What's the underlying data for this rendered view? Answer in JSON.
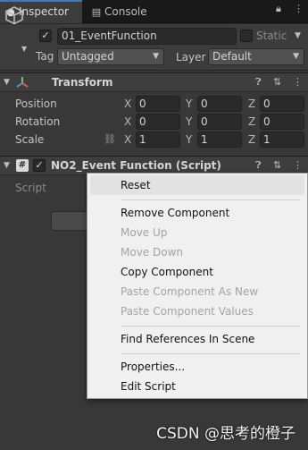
{
  "tabs": [
    {
      "label": "Inspector",
      "icon": "info-icon"
    },
    {
      "label": "Console",
      "icon": "console-icon"
    }
  ],
  "header": {
    "object_name": "01_EventFunction",
    "static_label": "Static",
    "tag_label": "Tag",
    "tag_value": "Untagged",
    "layer_label": "Layer",
    "layer_value": "Default"
  },
  "transform": {
    "title": "Transform",
    "rows": [
      {
        "label": "Position",
        "x": "0",
        "y": "0",
        "z": "0"
      },
      {
        "label": "Rotation",
        "x": "0",
        "y": "0",
        "z": "0"
      },
      {
        "label": "Scale",
        "x": "1",
        "y": "1",
        "z": "1"
      }
    ],
    "axes": [
      "X",
      "Y",
      "Z"
    ]
  },
  "script_component": {
    "title": "NO2_Event Function (Script)",
    "script_label": "Script"
  },
  "context_menu": {
    "items": [
      {
        "label": "Reset",
        "enabled": true
      },
      {
        "label": "Remove Component",
        "enabled": true
      },
      {
        "label": "Move Up",
        "enabled": false
      },
      {
        "label": "Move Down",
        "enabled": false
      },
      {
        "label": "Copy Component",
        "enabled": true
      },
      {
        "label": "Paste Component As New",
        "enabled": false
      },
      {
        "label": "Paste Component Values",
        "enabled": false
      },
      {
        "label": "Find References In Scene",
        "enabled": true
      },
      {
        "label": "Properties...",
        "enabled": true
      },
      {
        "label": "Edit Script",
        "enabled": true
      }
    ]
  },
  "watermark": "CSDN @思考的橙子",
  "colors": {
    "accent": "#3a79bb",
    "panel": "#383838",
    "menu_bg": "#f0f0f0"
  }
}
